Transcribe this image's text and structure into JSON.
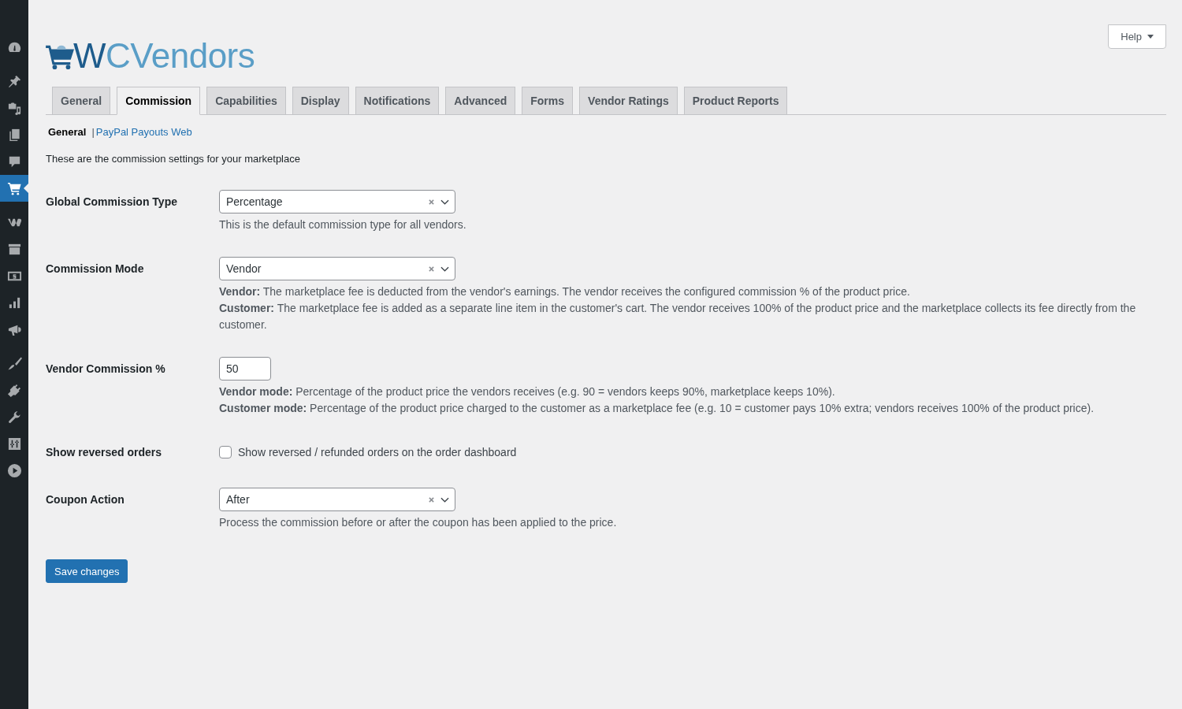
{
  "sidebar": {
    "groups": [
      {
        "items": [
          {
            "selected": false
          }
        ]
      },
      {
        "items": [
          {
            "selected": false
          },
          {
            "selected": false
          },
          {
            "selected": false
          },
          {
            "selected": false
          },
          {
            "selected": true
          }
        ]
      },
      {
        "items": [
          {
            "selected": false
          },
          {
            "selected": false
          },
          {
            "selected": false
          },
          {
            "selected": false
          },
          {
            "selected": false
          }
        ]
      },
      {
        "items": [
          {
            "selected": false
          },
          {
            "selected": false
          },
          {
            "selected": false
          },
          {
            "selected": false
          },
          {
            "selected": false
          }
        ]
      }
    ]
  },
  "header": {
    "logo": "WCVendors",
    "help_button": "Help"
  },
  "tabs": [
    {
      "label": "General",
      "selected": false
    },
    {
      "label": "Commission",
      "selected": true
    },
    {
      "label": "Capabilities",
      "selected": false
    },
    {
      "label": "Display",
      "selected": false
    },
    {
      "label": "Notifications",
      "selected": false
    },
    {
      "label": "Advanced",
      "selected": false
    },
    {
      "label": "Forms",
      "selected": false
    },
    {
      "label": "Vendor Ratings",
      "selected": false
    },
    {
      "label": "Product Reports",
      "selected": false
    }
  ],
  "subnav": {
    "separator": "|",
    "items": [
      {
        "label": "General",
        "selected": true
      },
      {
        "label": "PayPal Payouts Web",
        "selected": false
      }
    ]
  },
  "intro": "These are the commission settings for your marketplace",
  "fields": [
    {
      "kind": "select",
      "label": "Global Commission Type",
      "value": "Percentage",
      "description": [
        "This is the default commission type for all vendors."
      ]
    },
    {
      "kind": "select",
      "label": "Commission Mode",
      "value": "Vendor",
      "description": [
        "**Vendor:** The marketplace fee is deducted from the vendor's earnings. The vendor receives the configured commission % of the product price.",
        "**Customer:** The marketplace fee is added as a separate line item in the customer's cart. The vendor receives 100% of the product price and the marketplace collects its fee directly from the customer."
      ]
    },
    {
      "kind": "number",
      "label": "Vendor Commission %",
      "value": "50",
      "description": [
        "**Vendor mode:** Percentage of the product price the vendors receives (e.g. 90 = vendors keeps 90%, marketplace keeps 10%).",
        "**Customer mode:** Percentage of the product price charged to the customer as a marketplace fee (e.g. 10 = customer pays 10% extra; vendors receives 100% of the product price)."
      ]
    },
    {
      "kind": "checkbox",
      "label": "Show reversed orders",
      "checked": false,
      "option_label": "Show reversed / refunded orders on the order dashboard"
    },
    {
      "kind": "select",
      "label": "Coupon Action",
      "value": "After",
      "description": [
        "Process the commission before or after the coupon has been applied to the price."
      ]
    }
  ],
  "save_button": "Save changes"
}
